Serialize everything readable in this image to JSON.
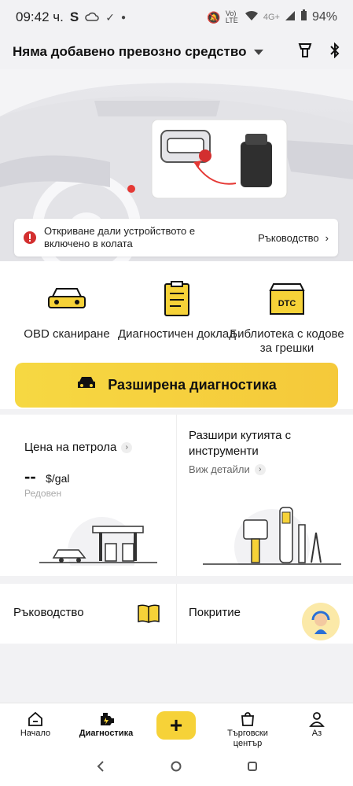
{
  "status": {
    "time": "09:42 ч.",
    "s_icon": "S",
    "signal_text": "Vo) LTE",
    "net": "4G+",
    "battery": "94%"
  },
  "header": {
    "vehicle_label": "Няма добавено превозно средство"
  },
  "notice": {
    "text": "Откриване дали устройството е включено в колата",
    "link": "Ръководство"
  },
  "tools": [
    {
      "label": "OBD сканиране"
    },
    {
      "label": "Диагностичен доклад"
    },
    {
      "label": "Библиотека с кодове за грешки",
      "badge": "DTC"
    }
  ],
  "advanced": {
    "label": "Разширена диагностика"
  },
  "fuel": {
    "title": "Цена на петрола",
    "price": "--",
    "unit": "$/gal",
    "type": "Редовен"
  },
  "toolbox": {
    "title": "Разшири кутията с инструменти",
    "details": "Виж детайли"
  },
  "row2": {
    "guide": "Ръководство",
    "coverage": "Покритие"
  },
  "nav": {
    "home": "Начало",
    "diagnostics": "Диагностика",
    "plus": "+",
    "store": "Търговски център",
    "me": "Аз"
  }
}
